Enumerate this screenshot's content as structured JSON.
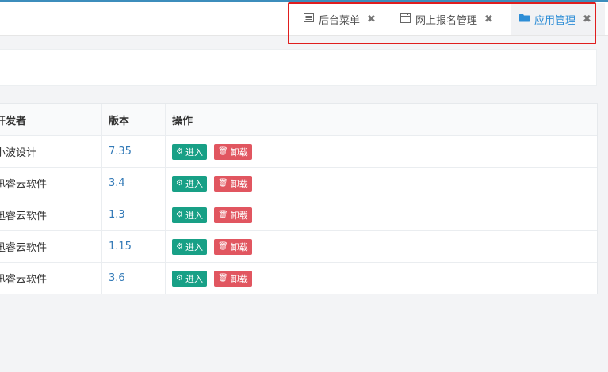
{
  "tabs": [
    {
      "label": "后台菜单",
      "icon": "list-icon",
      "active": false
    },
    {
      "label": "网上报名管理",
      "icon": "calendar-icon",
      "active": false
    },
    {
      "label": "应用管理",
      "icon": "folder-icon",
      "active": true
    }
  ],
  "table": {
    "headers": {
      "developer": "开发者",
      "version": "版本",
      "actions": "操作"
    },
    "rows": [
      {
        "developer": "小波设计",
        "version": "7.35"
      },
      {
        "developer": "迅睿云软件",
        "version": "3.4"
      },
      {
        "developer": "迅睿云软件",
        "version": "1.3"
      },
      {
        "developer": "迅睿云软件",
        "version": "1.15"
      },
      {
        "developer": "迅睿云软件",
        "version": "3.6"
      }
    ],
    "enter_label": "进入",
    "uninstall_label": "卸载"
  },
  "colors": {
    "accent": "#2e8ed6",
    "enter": "#18a086",
    "uninstall": "#e15660",
    "highlight": "#e01e1e"
  }
}
